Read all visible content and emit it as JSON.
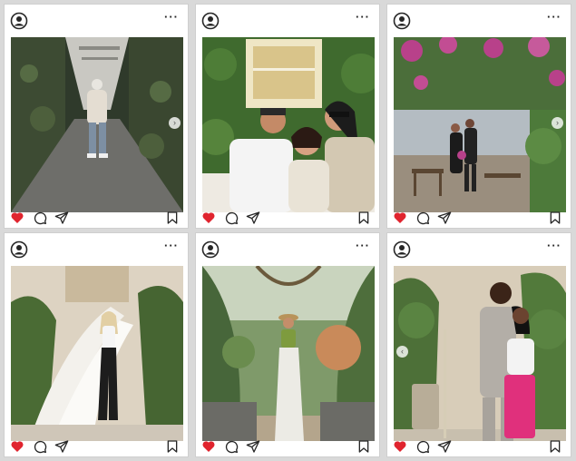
{
  "colors": {
    "like_red": "#e0242e",
    "icon_stroke": "#262626",
    "background": "#d9d9d9"
  },
  "icons": {
    "avatar": "user-circle-icon",
    "more": "more-dots-icon",
    "like": "heart-filled-icon",
    "comment": "comment-bubble-icon",
    "share": "paper-plane-icon",
    "save": "bookmark-icon"
  },
  "ui": {
    "more_glyph": "···"
  },
  "posts": [
    {
      "liked": true,
      "has_next_arrow": true,
      "has_prev_arrow": false
    },
    {
      "liked": true,
      "has_next_arrow": false,
      "has_prev_arrow": false
    },
    {
      "liked": true,
      "has_next_arrow": true,
      "has_prev_arrow": false
    },
    {
      "liked": true,
      "has_next_arrow": false,
      "has_prev_arrow": false
    },
    {
      "liked": true,
      "has_next_arrow": false,
      "has_prev_arrow": false
    },
    {
      "liked": true,
      "has_next_arrow": false,
      "has_prev_arrow": true
    }
  ]
}
